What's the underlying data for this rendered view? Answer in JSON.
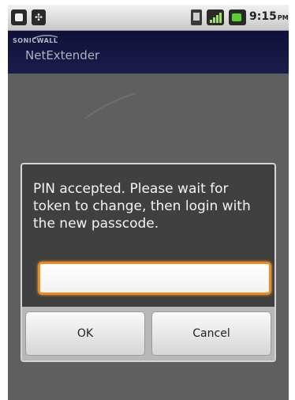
{
  "status_bar": {
    "time": "9:15",
    "ampm": "PM",
    "icons": [
      "photo-icon",
      "usb-icon",
      "sim-icon",
      "signal-icon",
      "battery-icon"
    ]
  },
  "app": {
    "brand": "SONICWALL",
    "title": "NetExtender"
  },
  "dialog": {
    "message": "PIN accepted. Please wait for token to change, then login with the new passcode.",
    "input_value": "",
    "ok_label": "OK",
    "cancel_label": "Cancel"
  },
  "colors": {
    "title_bar": "#10103a",
    "dialog_bg": "#404040",
    "input_focus": "#f08a1c",
    "battery": "#5bd02e",
    "signal": "#9fe36a"
  }
}
